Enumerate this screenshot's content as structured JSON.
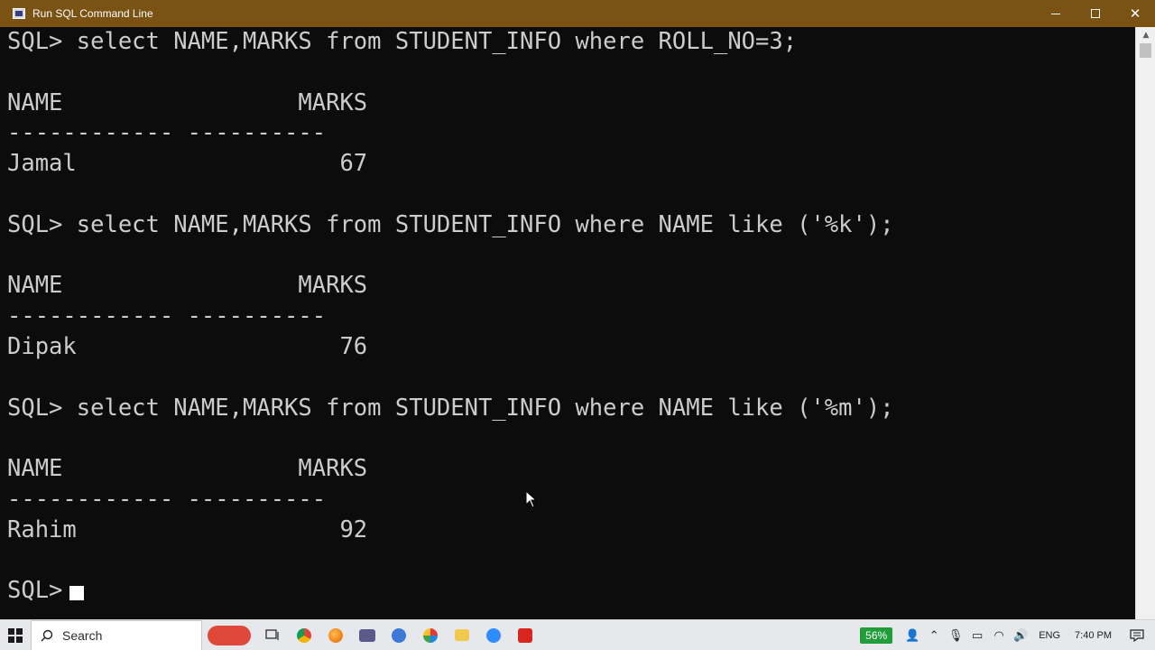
{
  "window": {
    "title": "Run SQL Command Line"
  },
  "console": {
    "lines": [
      "SQL> select NAME,MARKS from STUDENT_INFO where ROLL_NO=3;",
      "",
      "NAME                 MARKS",
      "------------ ----------",
      "Jamal                   67",
      "",
      "SQL> select NAME,MARKS from STUDENT_INFO where NAME like ('%k');",
      "",
      "NAME                 MARKS",
      "------------ ----------",
      "Dipak                   76",
      "",
      "SQL> select NAME,MARKS from STUDENT_INFO where NAME like ('%m');",
      "",
      "NAME                 MARKS",
      "------------ ----------",
      "Rahim                   92",
      "",
      "SQL>"
    ]
  },
  "taskbar": {
    "search_placeholder": "Search",
    "battery_percent": "56%",
    "language": "ENG",
    "time": "7:40 PM",
    "apps": [
      "food-thumbnail",
      "task-view-icon",
      "chrome-icon",
      "firefox-icon",
      "sql-cmd-icon",
      "app-icon",
      "paint-icon",
      "file-explorer-icon",
      "zoom-icon",
      "acrobat-icon"
    ]
  },
  "colors": {
    "titlebar_bg": "#7a5214",
    "console_bg": "#0c0c0c",
    "console_fg": "#cccccc",
    "taskbar_bg": "#e6e8ec",
    "battery_green": "#1f9e3a"
  }
}
